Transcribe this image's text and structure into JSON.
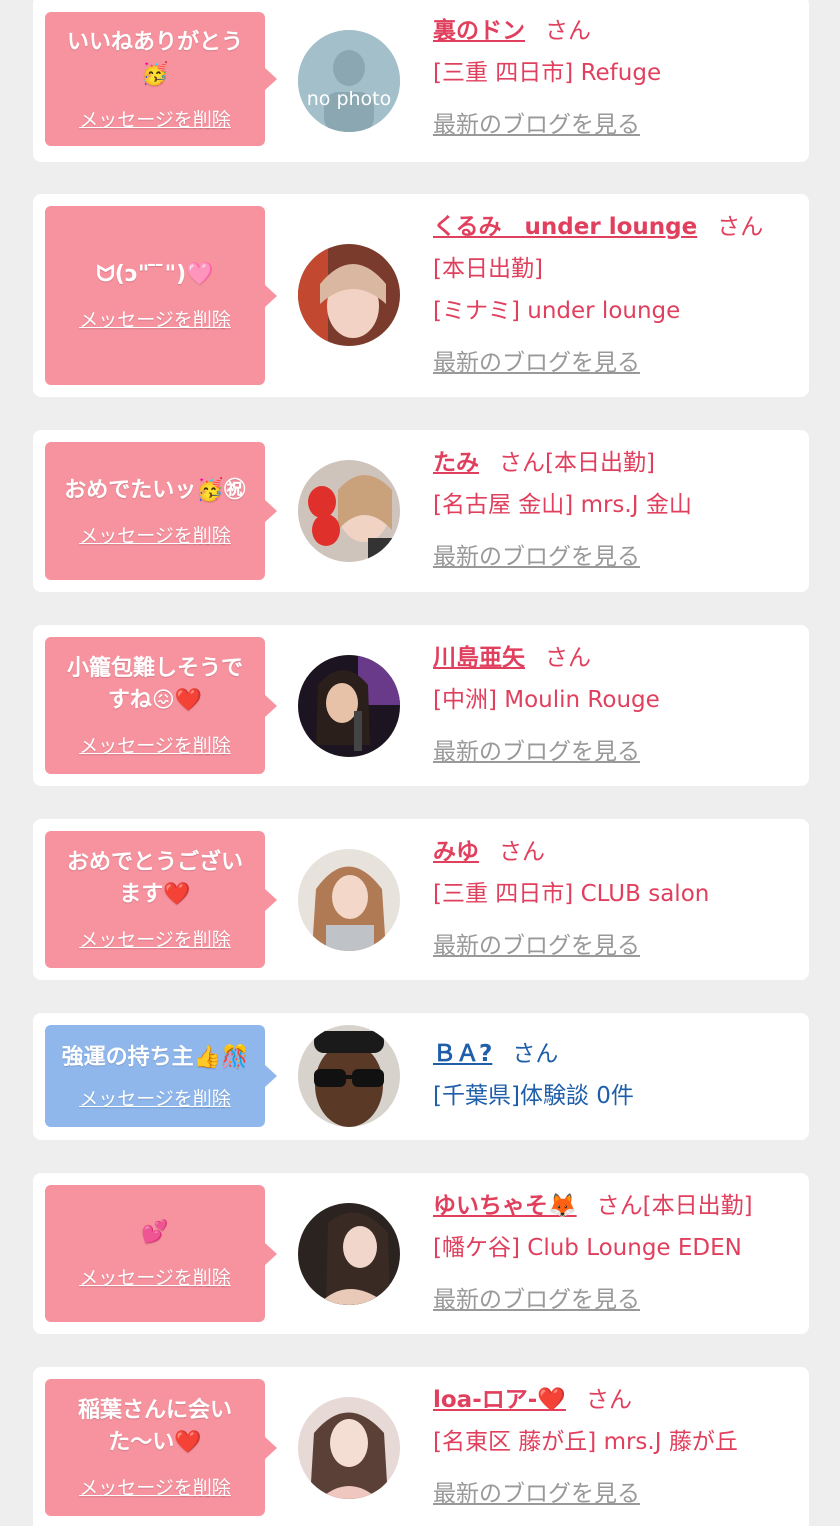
{
  "colors": {
    "pink_bubble": "#f7929f",
    "blue_bubble": "#8fb7ec",
    "pink_text": "#e0405e",
    "blue_text": "#1f5ea8",
    "gray_link": "#999999",
    "background": "#eeeeee"
  },
  "delete_label": "メッセージを削除",
  "blog_label": "最新のブログを見る",
  "items": [
    {
      "message": "いいねありがとう🥳",
      "name": "裏のドン",
      "san": "さん",
      "shop": "[三重 四日市] Refuge",
      "theme": "pink",
      "avatar_text": "no photo"
    },
    {
      "message": "ᗢ(ɔ\" ̄ ̄\")🩷",
      "name": "くるみ　under lounge",
      "san": "さん[本日出勤]",
      "shop": "[ミナミ] under lounge",
      "theme": "pink"
    },
    {
      "message": "おめでたいッ🥳㊗",
      "name": "たみ",
      "san": "さん[本日出勤]",
      "shop": "[名古屋 金山] mrs.J 金山",
      "theme": "pink"
    },
    {
      "message": "小籠包難しそうですね😖❤️",
      "name": "川島亜矢",
      "san": "さん",
      "shop": "[中洲] Moulin Rouge",
      "theme": "pink"
    },
    {
      "message": "おめでとうございます❤️",
      "name": "みゆ",
      "san": "さん",
      "shop": "[三重 四日市] CLUB salon",
      "theme": "pink"
    },
    {
      "message": "強運の持ち主👍🎊",
      "name": "ＢＡ?",
      "san": "さん",
      "shop": "[千葉県]体験談 0件",
      "theme": "blue"
    },
    {
      "message": "💕",
      "name": "ゆいちゃそ🦊",
      "san": "さん[本日出勤]",
      "shop": "[幡ケ谷] Club Lounge EDEN",
      "theme": "pink"
    },
    {
      "message": "稲葉さんに会いた〜い❤️",
      "name": "loa-ロア-❤️",
      "san": "さん",
      "shop": "[名東区 藤が丘] mrs.J 藤が丘",
      "theme": "pink"
    }
  ]
}
